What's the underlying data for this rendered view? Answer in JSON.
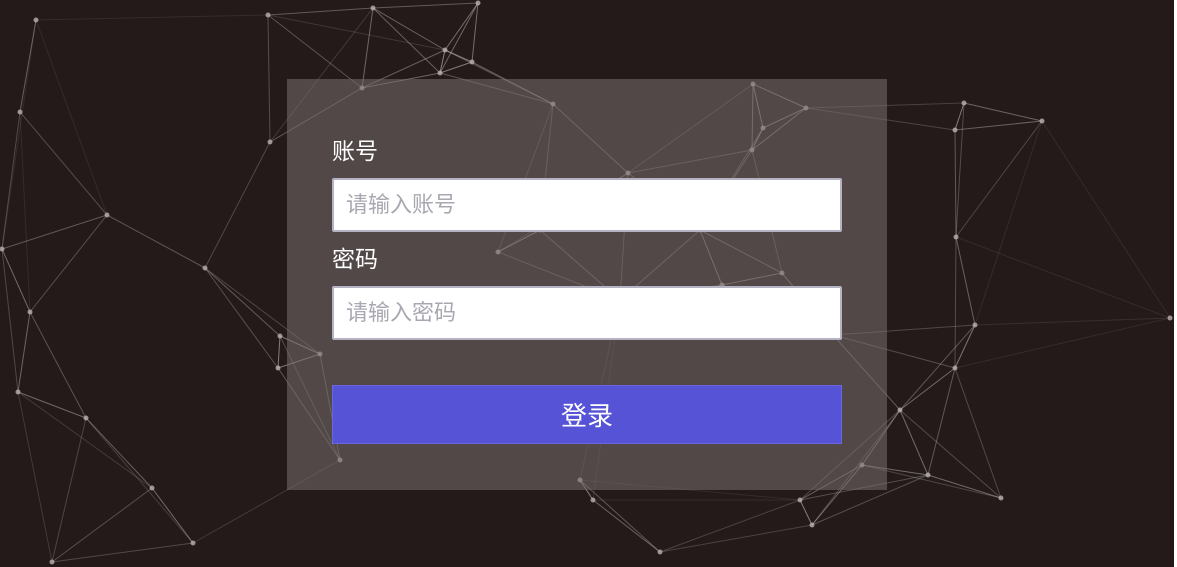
{
  "form": {
    "account_label": "账号",
    "account_placeholder": "请输入账号",
    "account_value": "",
    "password_label": "密码",
    "password_placeholder": "请输入密码",
    "password_value": "",
    "login_label": "登录"
  },
  "colors": {
    "background": "#231a19",
    "panel": "#6f6765",
    "button": "#5753d7",
    "network_line": "#b8b2b0"
  }
}
